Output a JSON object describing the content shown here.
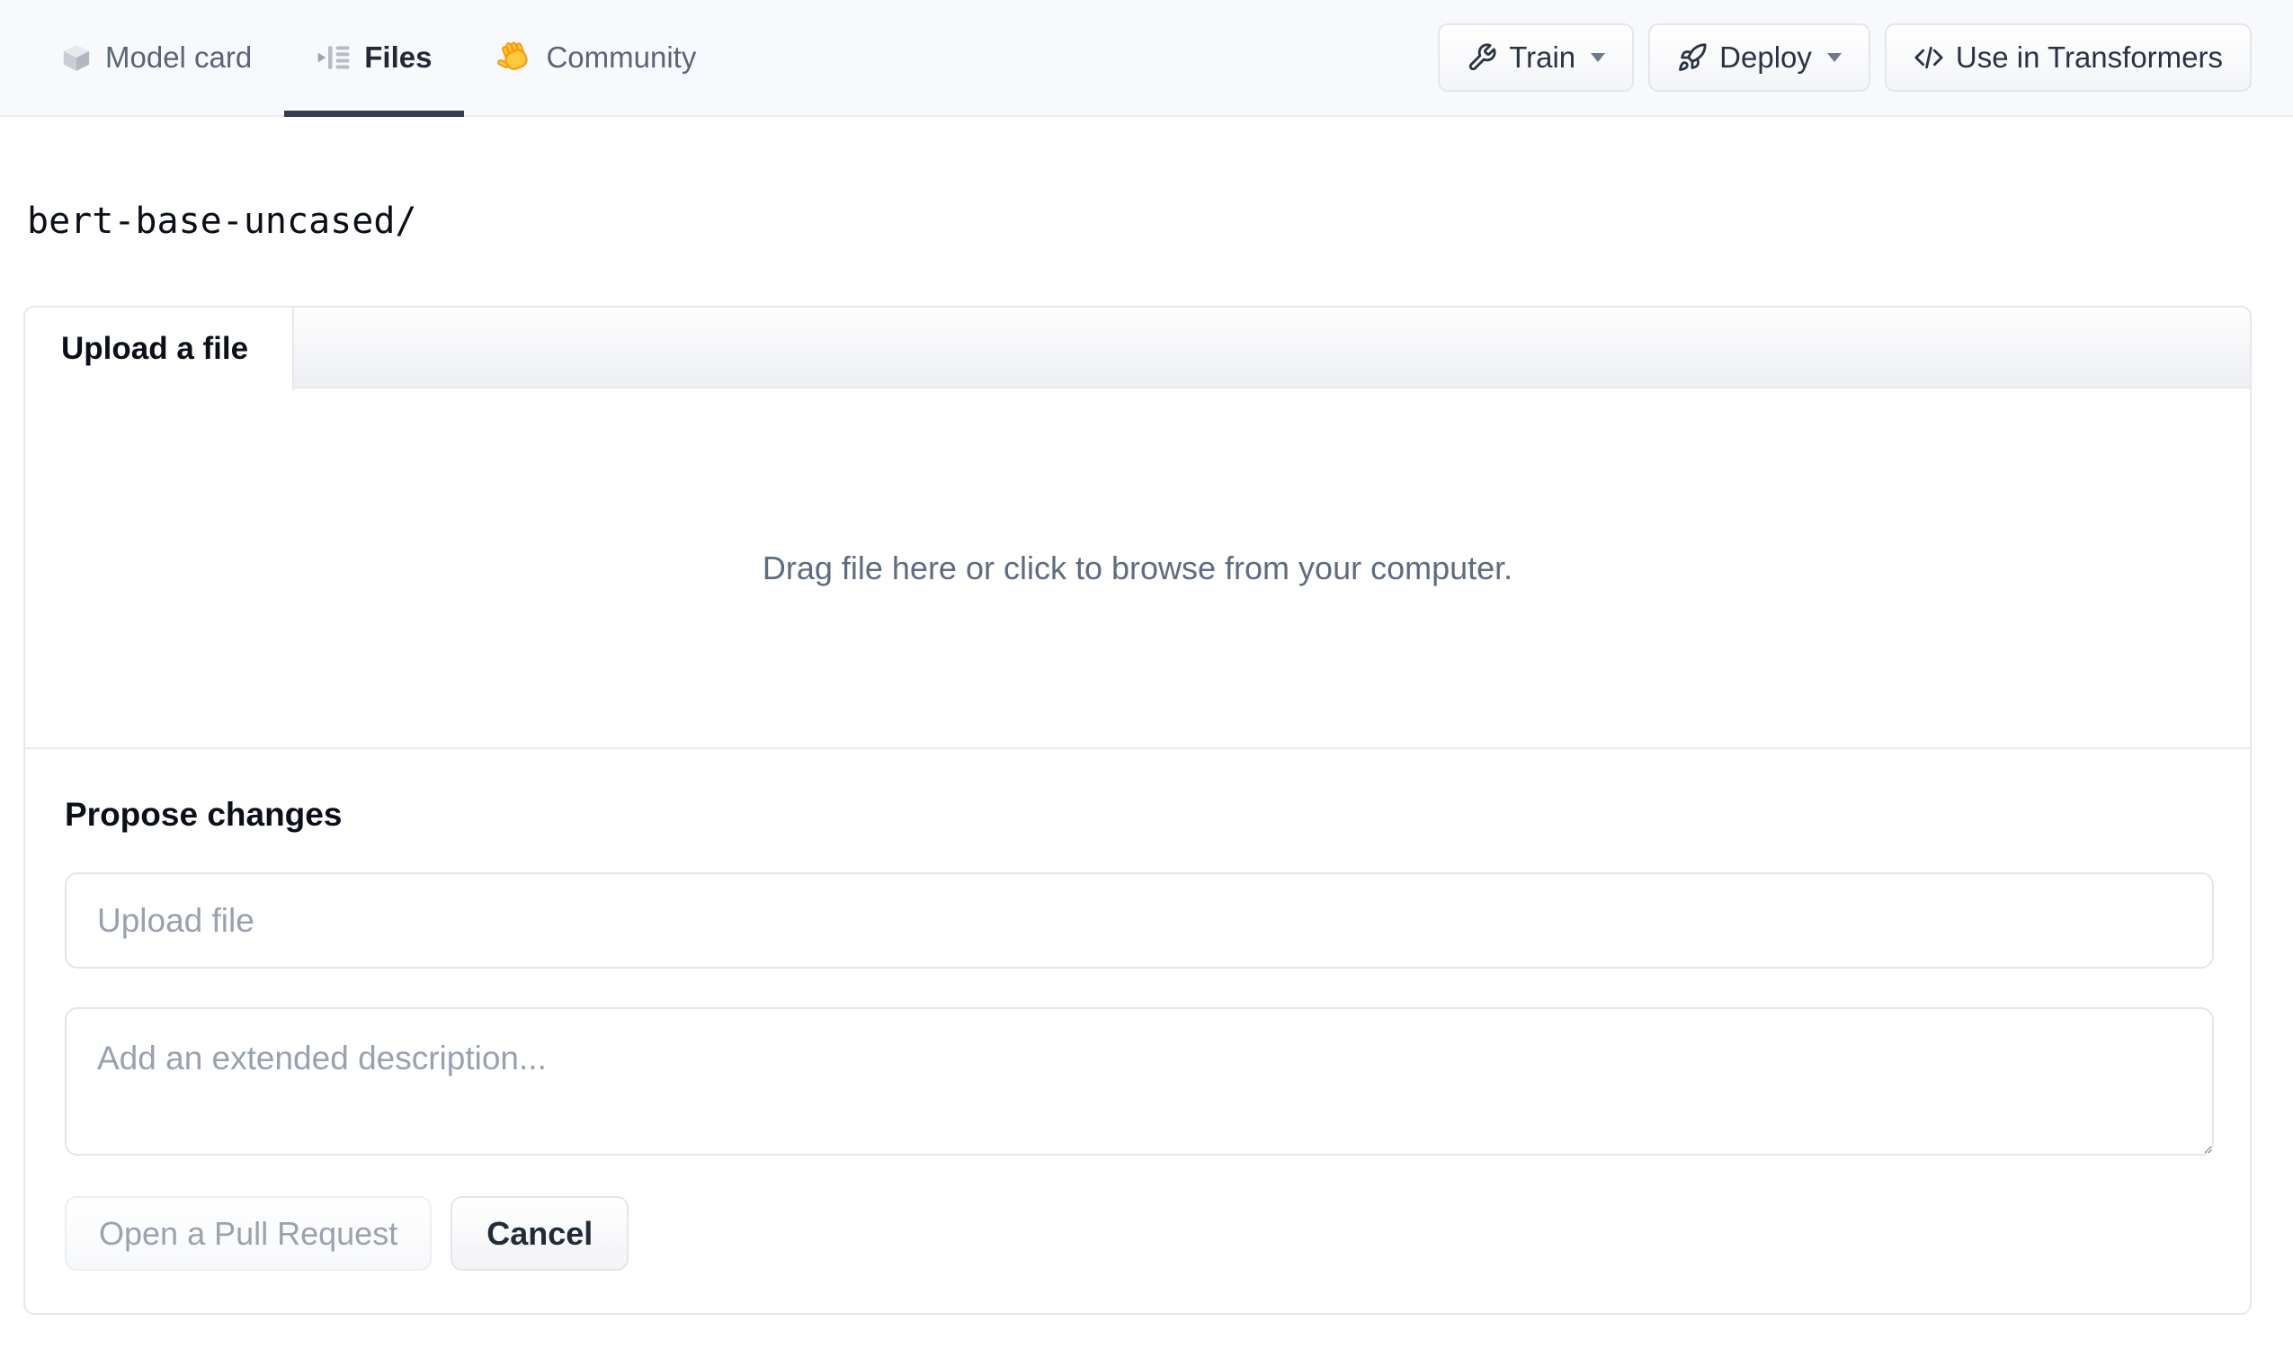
{
  "nav": {
    "tabs": [
      {
        "label": "Model card",
        "icon": "cube-icon",
        "active": false
      },
      {
        "label": "Files",
        "icon": "files-list-icon",
        "active": true
      },
      {
        "label": "Community",
        "icon": "waving-hand-icon",
        "active": false
      }
    ],
    "actions": [
      {
        "label": "Train",
        "icon": "wrench-icon",
        "has_caret": true
      },
      {
        "label": "Deploy",
        "icon": "rocket-icon",
        "has_caret": true
      },
      {
        "label": "Use in Transformers",
        "icon": "code-icon",
        "has_caret": false
      }
    ]
  },
  "breadcrumb": {
    "path": "bert-base-uncased/"
  },
  "upload_panel": {
    "tab_label": "Upload a file",
    "dropzone_text": "Drag file here or click to browse from your computer.",
    "propose": {
      "heading": "Propose changes",
      "filename_placeholder": "Upload file",
      "description_placeholder": "Add an extended description...",
      "open_pr_label": "Open a Pull Request",
      "cancel_label": "Cancel"
    }
  },
  "colors": {
    "nav_bg": "#f8f9fc",
    "active_tab": "#353e4f",
    "border": "#e5e7eb",
    "muted_text": "#5f6b81",
    "placeholder_text": "#99a1ae",
    "disabled_button_text": "#9aa2ad"
  }
}
